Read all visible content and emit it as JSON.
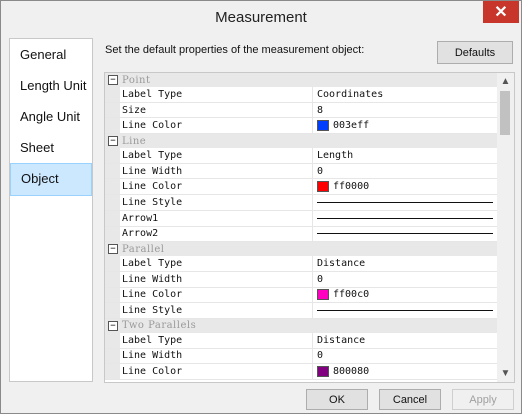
{
  "window": {
    "title": "Measurement",
    "close_glyph": "✕"
  },
  "sidebar": {
    "items": [
      {
        "label": "General"
      },
      {
        "label": "Length Unit"
      },
      {
        "label": "Angle Unit"
      },
      {
        "label": "Sheet"
      },
      {
        "label": "Object",
        "selected": true
      }
    ]
  },
  "description": "Set the default properties of the measurement object:",
  "defaults_label": "Defaults",
  "grid": {
    "categories": [
      {
        "label": "Point",
        "props": [
          {
            "name": "Label Type",
            "value": "Coordinates"
          },
          {
            "name": "Size",
            "value": "8"
          },
          {
            "name": "Line Color",
            "value": "003eff",
            "color": "#003eff"
          }
        ]
      },
      {
        "label": "Line",
        "props": [
          {
            "name": "Label Type",
            "value": "Length"
          },
          {
            "name": "Line Width",
            "value": "0"
          },
          {
            "name": "Line Color",
            "value": "ff0000",
            "color": "#ff0000"
          },
          {
            "name": "Line Style",
            "value": "",
            "line": true
          },
          {
            "name": "Arrow1",
            "value": "",
            "line": true
          },
          {
            "name": "Arrow2",
            "value": "",
            "line": true
          }
        ]
      },
      {
        "label": "Parallel",
        "props": [
          {
            "name": "Label Type",
            "value": "Distance"
          },
          {
            "name": "Line Width",
            "value": "0"
          },
          {
            "name": "Line Color",
            "value": "ff00c0",
            "color": "#ff00c0"
          },
          {
            "name": "Line Style",
            "value": "",
            "line": true
          }
        ]
      },
      {
        "label": "Two Parallels",
        "props": [
          {
            "name": "Label Type",
            "value": "Distance"
          },
          {
            "name": "Line Width",
            "value": "0"
          },
          {
            "name": "Line Color",
            "value": "800080",
            "color": "#800080"
          }
        ]
      }
    ]
  },
  "footer": {
    "ok": "OK",
    "cancel": "Cancel",
    "apply": "Apply"
  }
}
